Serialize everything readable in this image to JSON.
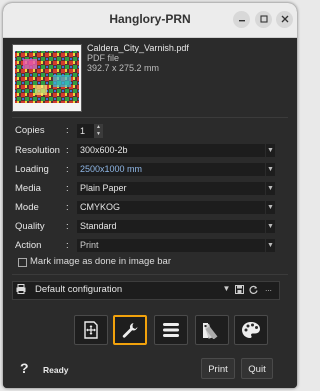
{
  "window": {
    "title": "Hanglory-PRN"
  },
  "file": {
    "name": "Caldera_City_Varnish.pdf",
    "type": "PDF file",
    "dimensions": "392.7 x 275.2 mm"
  },
  "settings": {
    "copies": {
      "label": "Copies",
      "value": "1"
    },
    "resolution": {
      "label": "Resolution",
      "value": "300x600-2b"
    },
    "loading": {
      "label": "Loading",
      "value": "2500x1000 mm"
    },
    "media": {
      "label": "Media",
      "value": "Plain Paper"
    },
    "mode": {
      "label": "Mode",
      "value": "CMYKOG"
    },
    "quality": {
      "label": "Quality",
      "value": "Standard"
    },
    "action": {
      "label": "Action",
      "value": "Print"
    }
  },
  "mark_image_label": "Mark image as done in image bar",
  "configuration": {
    "value": "Default configuration",
    "more_label": "..."
  },
  "toolbar": {
    "active_tool": "wrench-icon",
    "tools": [
      "page-layout-icon",
      "wrench-icon",
      "list-icon",
      "color-swatch-icon",
      "palette-icon"
    ]
  },
  "footer": {
    "help": "?",
    "status": "Ready",
    "print_label": "Print",
    "quit_label": "Quit"
  },
  "colors": {
    "accent": "#f2a20c",
    "background": "#2b2b2b",
    "field": "#1d1d1d",
    "link_value": "#8fb7e6"
  }
}
